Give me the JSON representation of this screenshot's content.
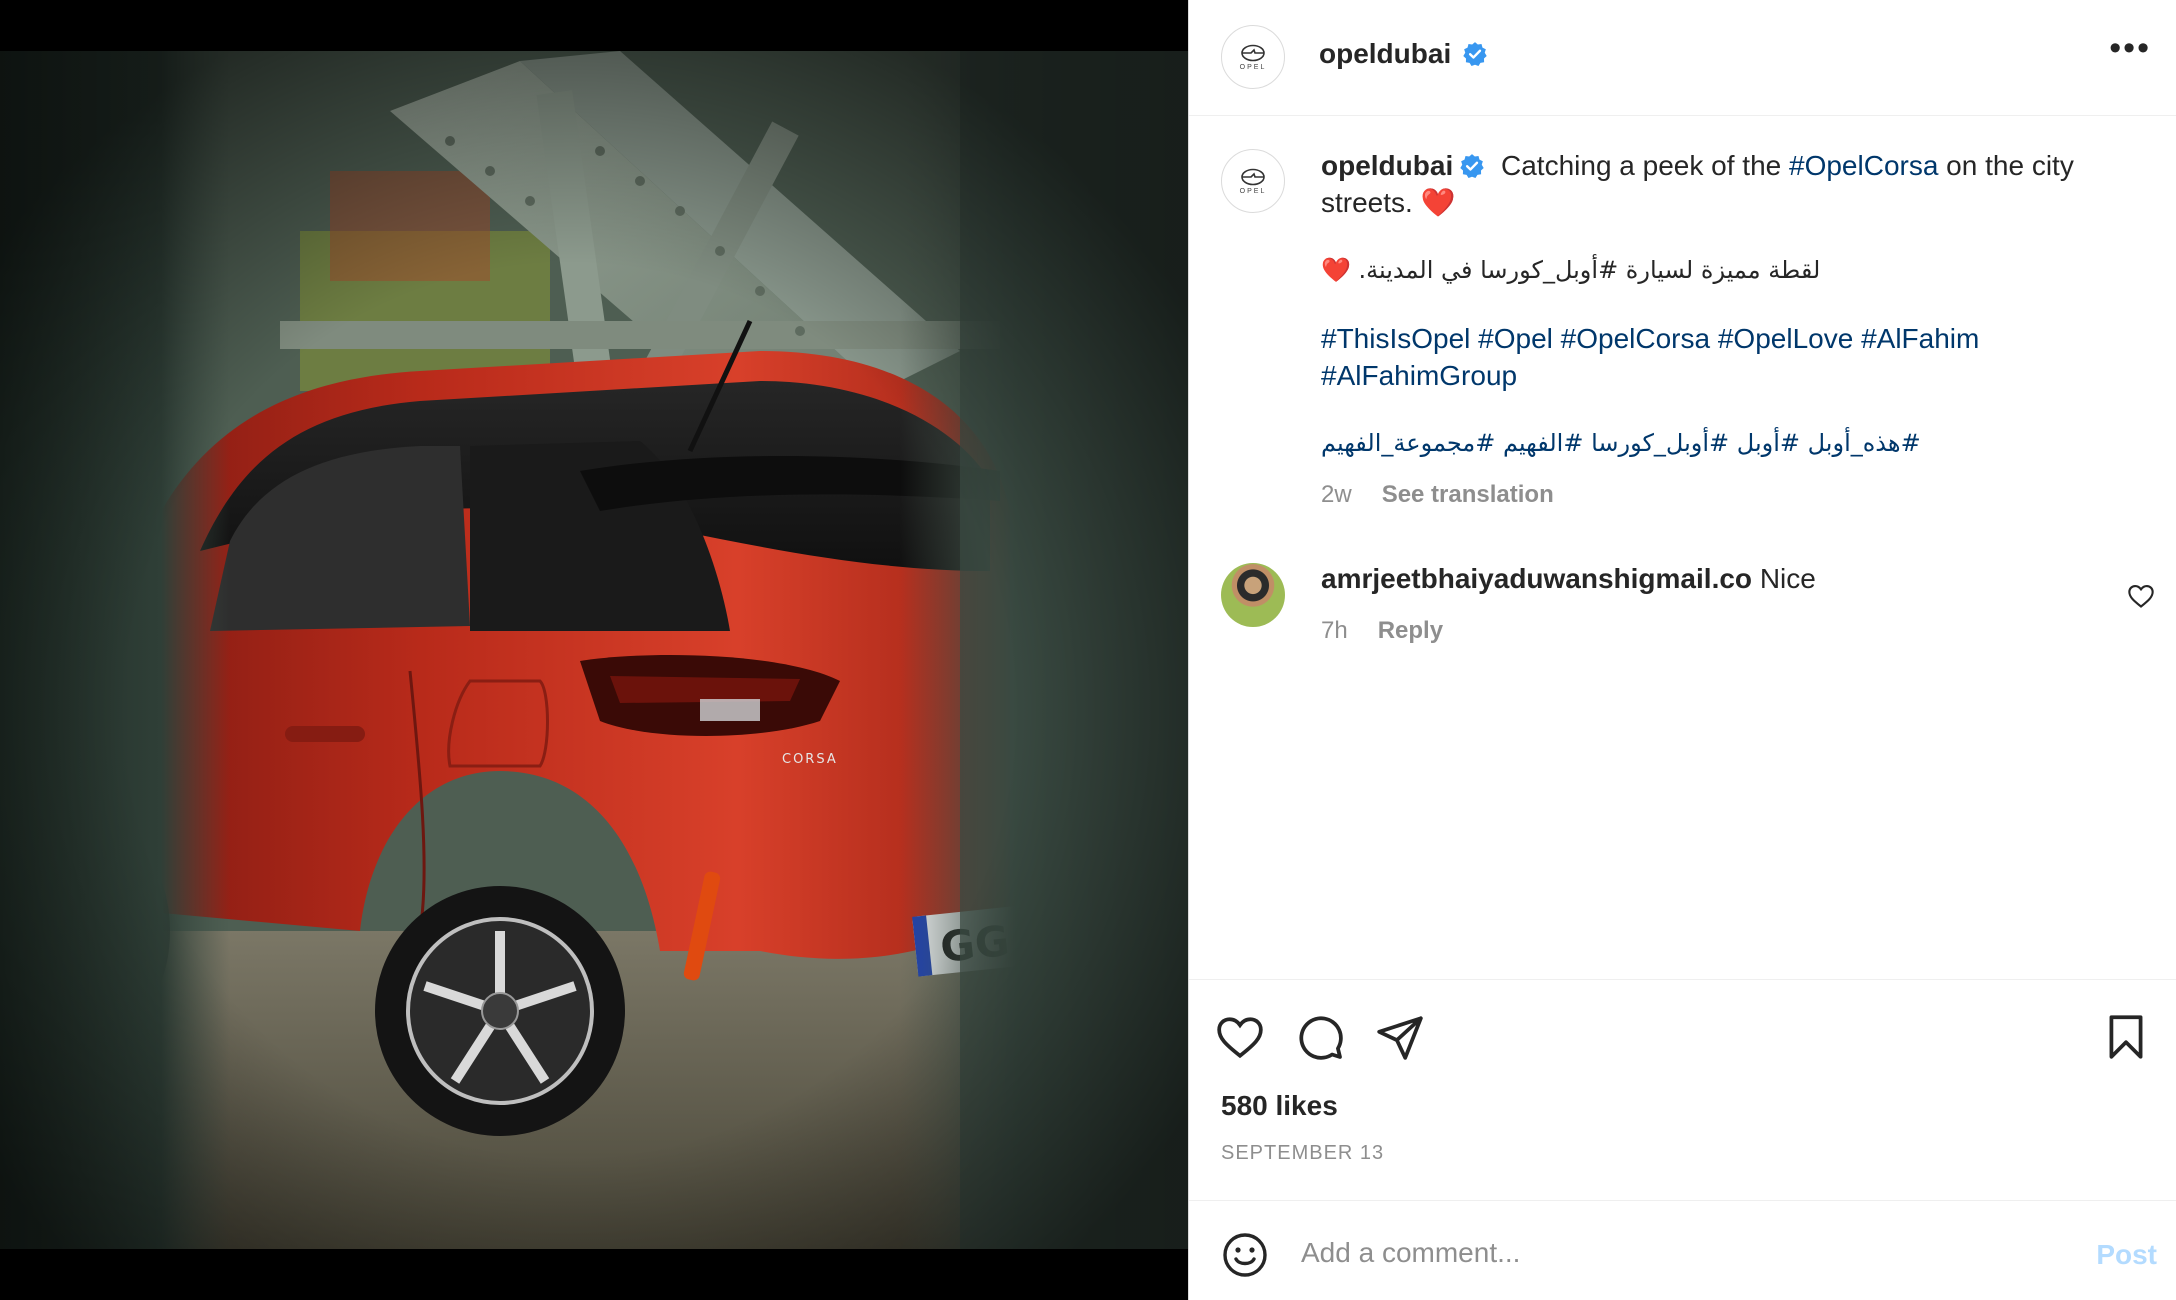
{
  "account": {
    "username": "opeldubai",
    "verified": true,
    "avatar_text": "OPEL"
  },
  "header": {
    "more_label": "•••"
  },
  "caption": {
    "username": "opeldubai",
    "line1_text": "Catching a peek of the ",
    "line1_tag": "#OpelCorsa",
    "line1_rest": " on the city streets. ",
    "heart_emoji": "❤️",
    "arabic_line": "لقطة مميزة لسيارة #أوبل_كورسا في المدينة. ❤️",
    "hashtags_en": "#ThisIsOpel #Opel #OpelCorsa #OpelLove #AlFahim #AlFahimGroup",
    "hashtags_ar": "#هذه_أوبل #أوبل #أوبل_كورسا #الفهيم #مجموعة_الفهيم",
    "time_ago": "2w",
    "see_translation": "See translation"
  },
  "comment": {
    "username": "amrjeetbhaiyaduwanshigmail.co",
    "text": "Nice",
    "time_ago": "7h",
    "reply": "Reply"
  },
  "post": {
    "likes": "580 likes",
    "date": "SEPTEMBER 13"
  },
  "add_comment": {
    "placeholder": "Add a comment...",
    "post_label": "Post"
  },
  "colors": {
    "link": "#00376b",
    "verified_blue": "#3897f0",
    "car_red": "#c8321f",
    "post_disabled": "#b3dbff"
  },
  "icons": [
    "opel-logo-icon",
    "verified-badge-icon",
    "more-options-icon",
    "like-heart-icon",
    "comment-bubble-icon",
    "share-plane-icon",
    "bookmark-icon",
    "comment-like-heart-icon",
    "emoji-icon"
  ]
}
